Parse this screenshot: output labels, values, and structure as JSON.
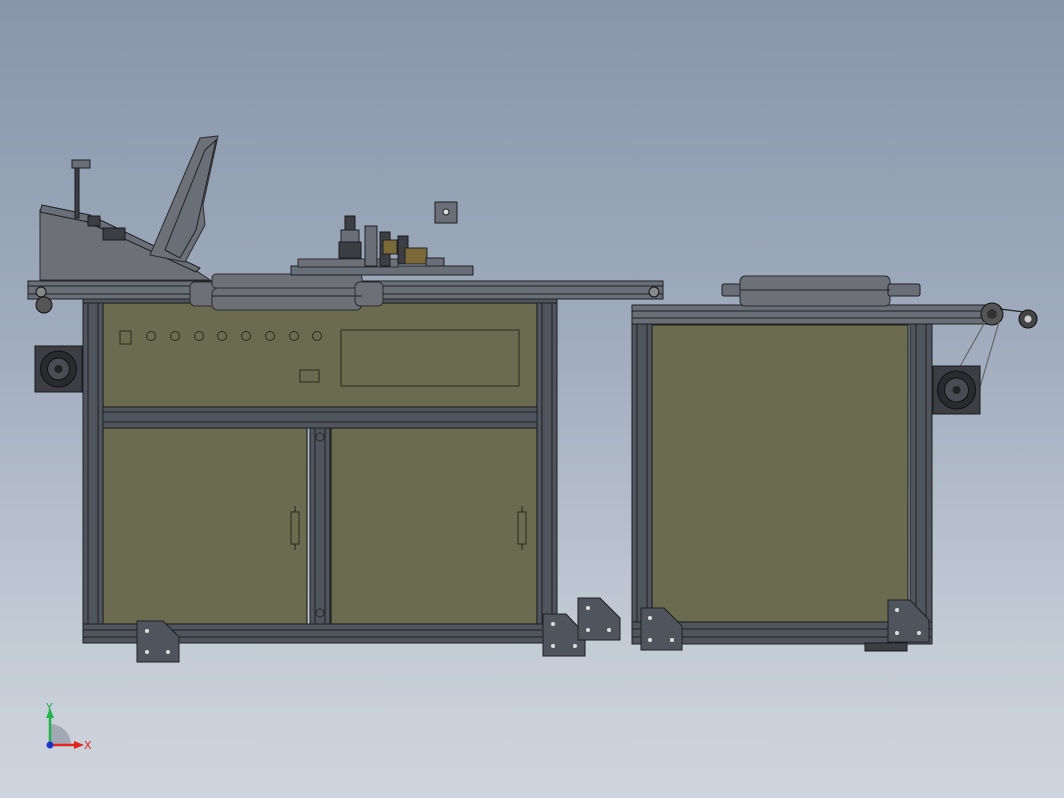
{
  "axes": {
    "y_label": "Y",
    "x_label": "X",
    "colors": {
      "y": "#22b14c",
      "x": "#e0261c",
      "z": "#2233cc"
    }
  },
  "colors": {
    "background_top": "#8796aa",
    "background_bottom": "#cfd5de",
    "panel": "#6b6b4f",
    "frame": "#50545c"
  }
}
